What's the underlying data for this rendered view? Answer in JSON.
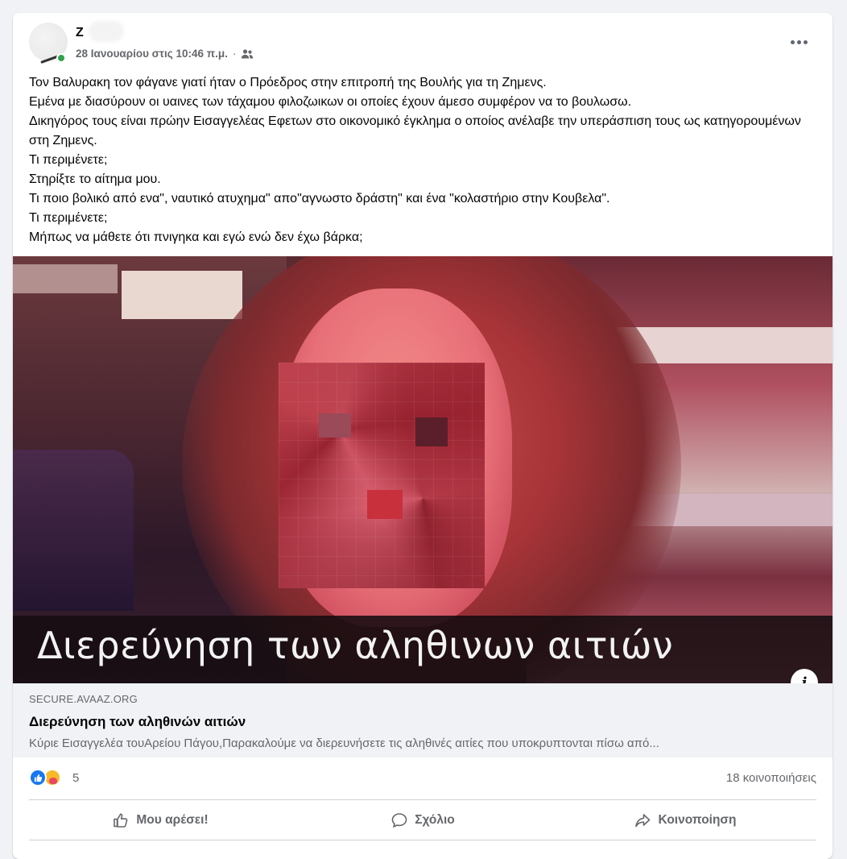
{
  "post": {
    "author": "Ζ",
    "timestamp": "28 Ιανουαρίου στις 10:46 π.μ.",
    "audience_icon": "friends-icon",
    "more_icon": "more-options-icon",
    "text_lines": [
      "Τον Βαλυρακη τον φάγανε γιατί ήταν ο Πρόεδρος στην επιτροπή της Βουλής για τη Ζημενς.",
      "Εμένα με διασύρουν οι υαινες των τάχαμου φιλοζωικων οι οποίες έχουν άμεσο συμφέρον να το βουλωσω.",
      "Δικηγόρος τους είναι πρώην Εισαγγελέας Εφετων στο οικονομικό έγκλημα ο οποίος ανέλαβε την υπεράσπιση τους ως κατηγορουμένων στη Ζημενς.",
      "Τι περιμένετε;",
      "Στηρίξτε το αίτημα μου.",
      "Τι ποιο βολικό από ενα\", ναυτικό ατυχημα\" απο\"αγνωστο δράστη\" και ένα \"κολαστήριο στην Κουβελα\".",
      "Τι περιμένετε;",
      "Μήπως να μάθετε ότι πνιγηκα και εγώ ενώ δεν έχω βάρκα;"
    ]
  },
  "media": {
    "caption": "Διερεύνηση των αληθινων αιτιών",
    "info_label": "i"
  },
  "link": {
    "domain": "SECURE.AVAAZ.ORG",
    "title": "Διερεύνηση των αληθινών αιτιών",
    "description": "Κύριε Εισαγγελέα τουΑρείου Πάγου,Παρακαλούμε να διερευνήσετε τις αληθινές αιτίες που υποκρυπτονται πίσω από..."
  },
  "stats": {
    "reaction_count": "5",
    "shares": "18 κοινοποιήσεις"
  },
  "actions": {
    "like": "Μου αρέσει!",
    "comment": "Σχόλιο",
    "share": "Κοινοποίηση"
  },
  "colors": {
    "accent": "#1877f2",
    "secondary_text": "#65676b",
    "online": "#31a24c"
  }
}
